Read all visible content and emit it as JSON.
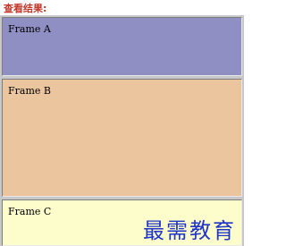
{
  "header": {
    "title": "查看结果:"
  },
  "frames": {
    "a": {
      "label": "Frame A"
    },
    "b": {
      "label": "Frame B"
    },
    "c": {
      "label": "Frame C"
    }
  },
  "watermark": {
    "text": "最需教育"
  },
  "colors": {
    "title_text": "#c0392b",
    "frame_a_bg": "#8f8fc3",
    "frame_b_bg": "#ebc59d",
    "frame_c_bg": "#fdfdcc",
    "frame_separator": "#c8c8c8",
    "watermark_text": "#1f35c8"
  }
}
